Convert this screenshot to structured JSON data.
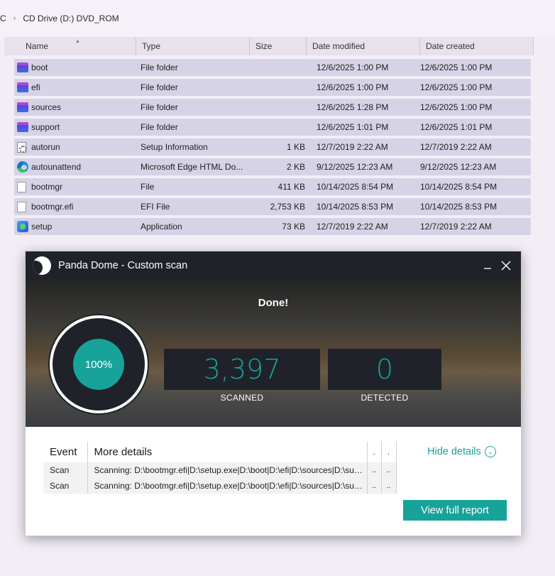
{
  "explorer": {
    "breadcrumb": [
      "PC",
      "CD Drive (D:) DVD_ROM"
    ],
    "columns": [
      "Name",
      "Type",
      "Size",
      "Date modified",
      "Date created"
    ],
    "files": [
      {
        "name": "boot",
        "type": "File folder",
        "size": "",
        "modified": "12/6/2025 1:00 PM",
        "created": "12/6/2025 1:00 PM",
        "icon": "folder-icon"
      },
      {
        "name": "efi",
        "type": "File folder",
        "size": "",
        "modified": "12/6/2025 1:00 PM",
        "created": "12/6/2025 1:00 PM",
        "icon": "folder-icon"
      },
      {
        "name": "sources",
        "type": "File folder",
        "size": "",
        "modified": "12/6/2025 1:28 PM",
        "created": "12/6/2025 1:00 PM",
        "icon": "folder-icon"
      },
      {
        "name": "support",
        "type": "File folder",
        "size": "",
        "modified": "12/6/2025 1:01 PM",
        "created": "12/6/2025 1:01 PM",
        "icon": "folder-icon"
      },
      {
        "name": "autorun",
        "type": "Setup Information",
        "size": "1 KB",
        "modified": "12/7/2019 2:22 AM",
        "created": "12/7/2019 2:22 AM",
        "icon": "inf-file-icon"
      },
      {
        "name": "autounattend",
        "type": "Microsoft Edge HTML Do...",
        "size": "2 KB",
        "modified": "9/12/2025 12:23 AM",
        "created": "9/12/2025 12:23 AM",
        "icon": "edge-icon"
      },
      {
        "name": "bootmgr",
        "type": "File",
        "size": "411 KB",
        "modified": "10/14/2025 8:54 PM",
        "created": "10/14/2025 8:54 PM",
        "icon": "file-icon"
      },
      {
        "name": "bootmgr.efi",
        "type": "EFI File",
        "size": "2,753 KB",
        "modified": "10/14/2025 8:53 PM",
        "created": "10/14/2025 8:53 PM",
        "icon": "file-icon"
      },
      {
        "name": "setup",
        "type": "Application",
        "size": "73 KB",
        "modified": "12/7/2019 2:22 AM",
        "created": "12/7/2019 2:22 AM",
        "icon": "setup-app-icon"
      }
    ]
  },
  "dialog": {
    "title": "Panda Dome - Custom scan",
    "status": "Done!",
    "progress_label": "100%",
    "progress": 1.0,
    "scanned_value": "3,397",
    "scanned_label": "SCANNED",
    "detected_value": "0",
    "detected_label": "DETECTED",
    "details_headers": [
      "Event",
      "More details",
      ".",
      "."
    ],
    "details_rows": [
      {
        "event": "Scan",
        "details": "Scanning: D:\\bootmgr.efi|D:\\setup.exe|D:\\boot|D:\\efi|D:\\sources|D:\\support|D:\\autorun.inf",
        "c3": "..",
        "c4": ".."
      },
      {
        "event": "Scan",
        "details": "Scanning: D:\\bootmgr.efi|D:\\setup.exe|D:\\boot|D:\\efi|D:\\sources|D:\\support|D:\\autorun.inf",
        "c3": "..",
        "c4": ".."
      }
    ],
    "hide_details_label": "Hide details",
    "report_button_label": "View full report",
    "accent_color": "#17a39a"
  }
}
